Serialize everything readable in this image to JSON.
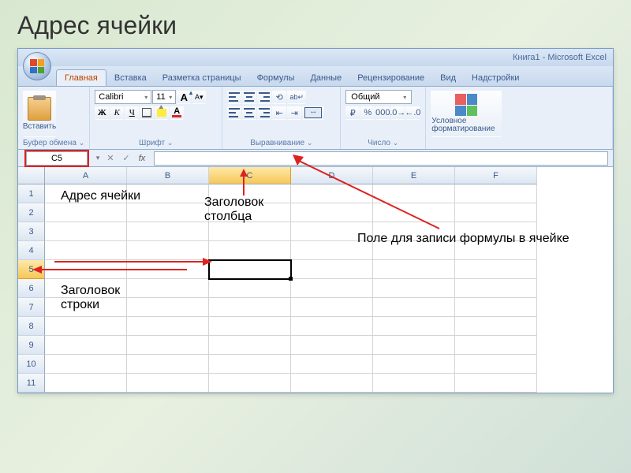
{
  "slide": {
    "title": "Адрес ячейки"
  },
  "window": {
    "title": "Книга1 - Microsoft Excel"
  },
  "tabs": [
    "Главная",
    "Вставка",
    "Разметка страницы",
    "Формулы",
    "Данные",
    "Рецензирование",
    "Вид",
    "Надстройки"
  ],
  "ribbon": {
    "clipboard": {
      "label": "Буфер обмена",
      "paste": "Вставить"
    },
    "font": {
      "label": "Шрифт",
      "name": "Calibri",
      "size": "11"
    },
    "align": {
      "label": "Выравнивание"
    },
    "number": {
      "label": "Число",
      "format": "Общий"
    },
    "styles": {
      "label": "Условное форматирование"
    }
  },
  "namebox": "C5",
  "columns": [
    "A",
    "B",
    "C",
    "D",
    "E",
    "F"
  ],
  "rows": [
    "1",
    "2",
    "3",
    "4",
    "5",
    "6",
    "7",
    "8",
    "9",
    "10",
    "11"
  ],
  "active_cell": {
    "col": 2,
    "row": 4
  },
  "annotations": {
    "cell_address": "Адрес ячейки",
    "col_header": "Заголовок столбца",
    "row_header": "Заголовок строки",
    "formula_field": "Поле для записи формулы в ячейке"
  }
}
